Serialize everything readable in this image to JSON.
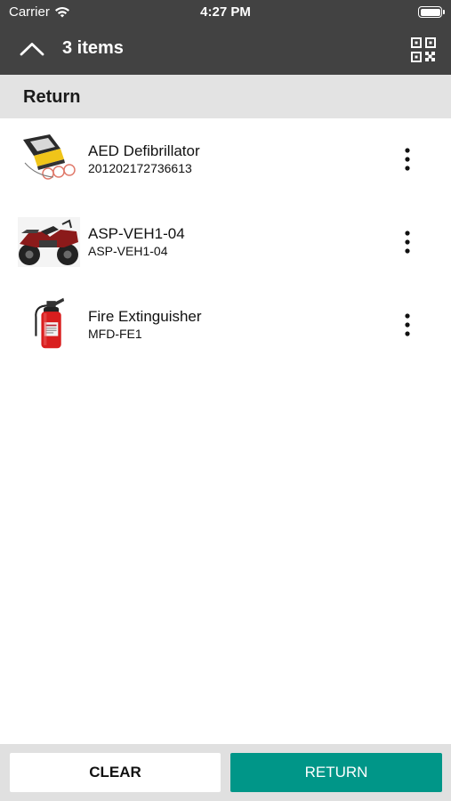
{
  "status_bar": {
    "carrier": "Carrier",
    "time": "4:27 PM"
  },
  "app_bar": {
    "title": "3 items"
  },
  "section": {
    "title": "Return"
  },
  "items": [
    {
      "name": "AED Defibrillator",
      "subtitle": "201202172736613",
      "image": "aed-defibrillator-image"
    },
    {
      "name": "ASP-VEH1-04",
      "subtitle": "ASP-VEH1-04",
      "image": "atv-vehicle-image"
    },
    {
      "name": "Fire Extinguisher",
      "subtitle": "MFD-FE1",
      "image": "fire-extinguisher-image"
    }
  ],
  "buttons": {
    "clear": "CLEAR",
    "return": "RETURN"
  },
  "colors": {
    "app_bar": "#424242",
    "section_header": "#e3e3e3",
    "accent": "#009688",
    "bottom_bar": "#e0e0e0"
  }
}
